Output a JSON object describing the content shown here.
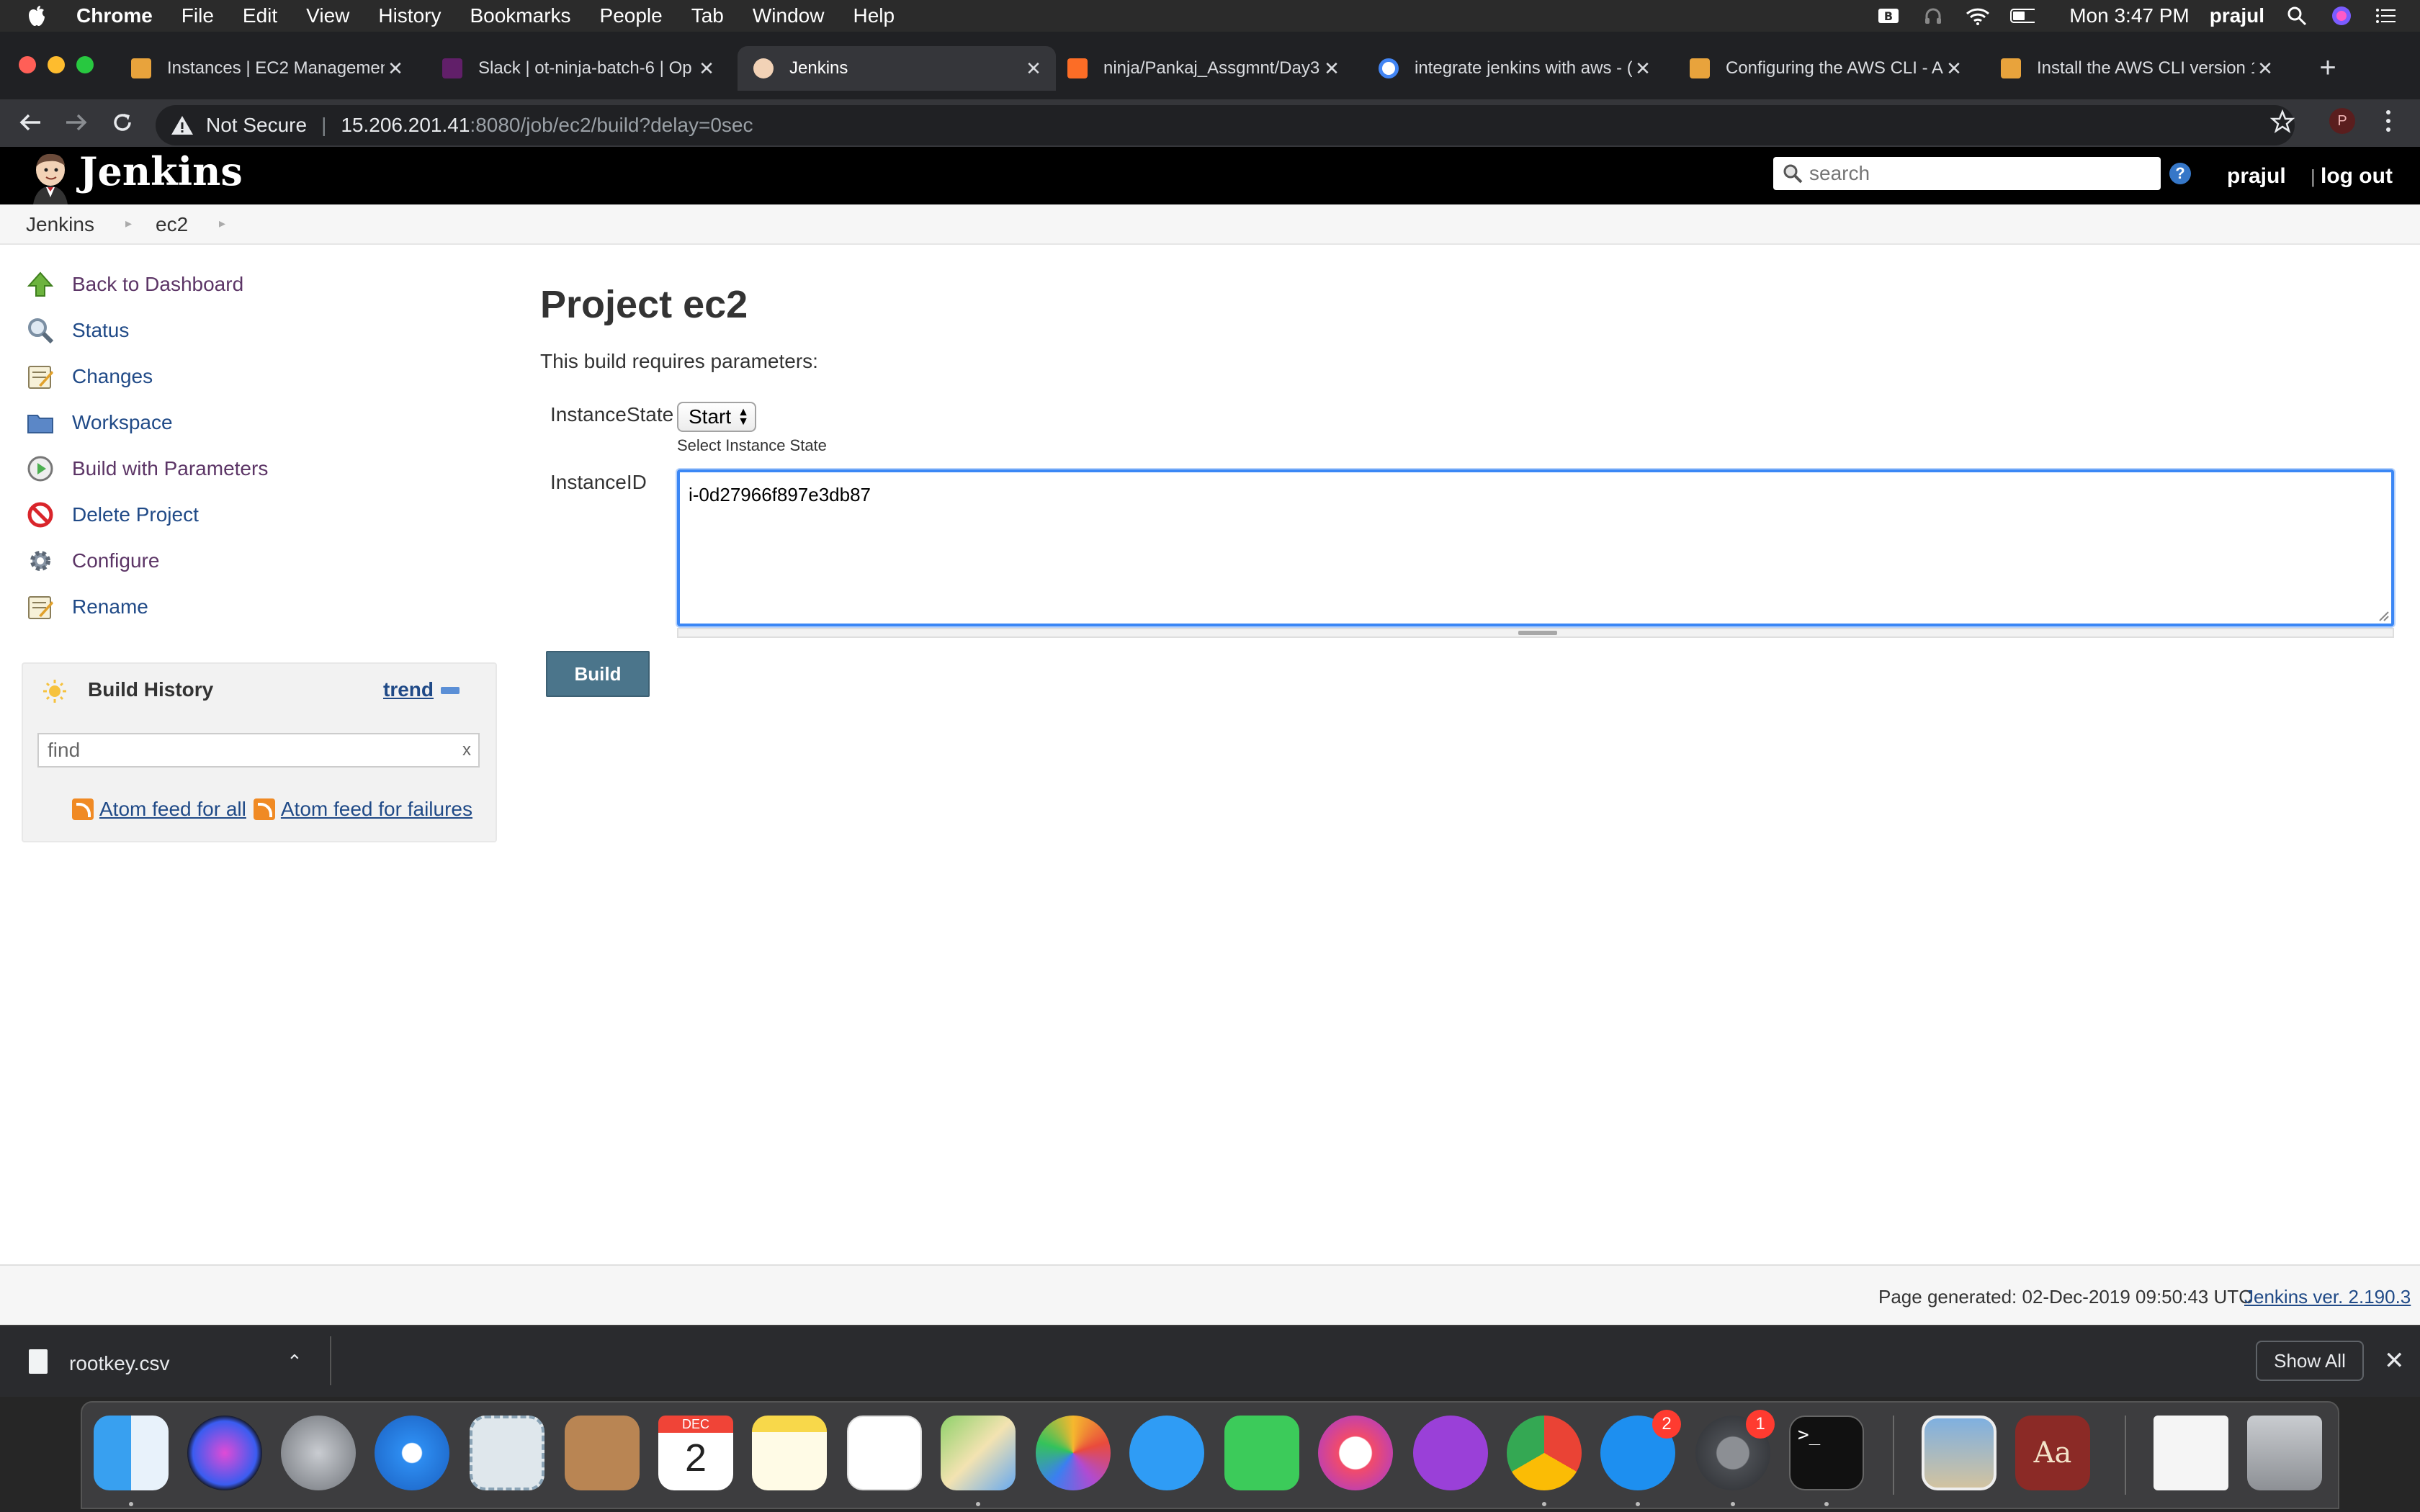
{
  "menubar": {
    "app": "Chrome",
    "items": [
      "File",
      "Edit",
      "View",
      "History",
      "Bookmarks",
      "People",
      "Tab",
      "Window",
      "Help"
    ],
    "clock": "Mon 3:47 PM",
    "user": "prajul"
  },
  "tabs": [
    {
      "label": "Instances | EC2 Managemen",
      "favicon": "aws-box-icon"
    },
    {
      "label": "Slack | ot-ninja-batch-6 | Op",
      "favicon": "slack-icon"
    },
    {
      "label": "Jenkins",
      "favicon": "jenkins-icon",
      "active": true
    },
    {
      "label": "ninja/Pankaj_Assgmnt/Day3",
      "favicon": "gitlab-icon"
    },
    {
      "label": "integrate jenkins with aws - (",
      "favicon": "google-icon"
    },
    {
      "label": "Configuring the AWS CLI - A",
      "favicon": "aws-box-icon"
    },
    {
      "label": "Install the AWS CLI version 1",
      "favicon": "aws-box-icon"
    }
  ],
  "omnibox": {
    "security": "Not Secure",
    "host": "15.206.201.41",
    "path": ":8080/job/ec2/build?delay=0sec",
    "profile_initial": "P"
  },
  "jenkins": {
    "title": "Jenkins",
    "search_placeholder": "search",
    "user": "prajul",
    "logout": "log out",
    "help": "?"
  },
  "breadcrumb": [
    "Jenkins",
    "ec2"
  ],
  "tasks": [
    {
      "label": "Back to Dashboard",
      "icon": "up-arrow-icon"
    },
    {
      "label": "Status",
      "icon": "magnifier-icon"
    },
    {
      "label": "Changes",
      "icon": "notepad-icon"
    },
    {
      "label": "Workspace",
      "icon": "folder-icon"
    },
    {
      "label": "Build with Parameters",
      "icon": "clock-play-icon"
    },
    {
      "label": "Delete Project",
      "icon": "no-entry-icon"
    },
    {
      "label": "Configure",
      "icon": "gear-icon"
    },
    {
      "label": "Rename",
      "icon": "notepad-icon"
    }
  ],
  "build_history": {
    "title": "Build History",
    "trend": "trend",
    "find_placeholder": "find",
    "clear": "x",
    "feed_all": "Atom feed for all",
    "feed_failures": "Atom feed for failures"
  },
  "main": {
    "heading": "Project ec2",
    "subtitle": "This build requires parameters:",
    "param1_label": "InstanceState",
    "param1_value": "Start",
    "param1_hint": "Select Instance State",
    "param2_label": "InstanceID",
    "param2_value": "i-0d27966f897e3db87",
    "build_button": "Build"
  },
  "footer": {
    "generated": "Page generated: 02-Dec-2019 09:50:43 UTC",
    "version": "Jenkins ver. 2.190.3"
  },
  "downloads": {
    "file": "rootkey.csv",
    "show_all": "Show All"
  },
  "dock": {
    "calendar_month": "DEC",
    "calendar_day": "2",
    "appstore_badge": "2",
    "prefs_badge": "1"
  },
  "colors": {
    "jenkins_header": "#000000",
    "link": "#204a87",
    "visited": "#5c3566",
    "build_button": "#4b758b",
    "focus_ring": "#3b87f5"
  }
}
